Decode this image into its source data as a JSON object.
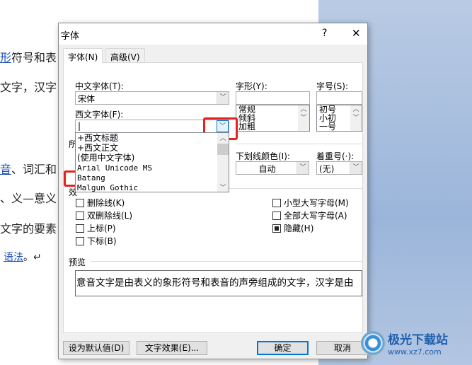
{
  "document": {
    "lines": [
      {
        "link": "形",
        "text": "符号和表"
      },
      {
        "link": "",
        "text": "文字，汉字"
      },
      {
        "link": "音",
        "text": "、词汇和"
      },
      {
        "link": "",
        "text": "、义—意义"
      },
      {
        "link": "",
        "text": "文字的要素"
      },
      {
        "link": "语法",
        "text": "。↵"
      }
    ]
  },
  "dialog": {
    "title": "字体",
    "help": "?",
    "close": "✕",
    "tabs": [
      {
        "label": "字体(N)",
        "active": true
      },
      {
        "label": "高级(V)",
        "active": false
      }
    ],
    "chinese_font": {
      "label": "中文字体(T):",
      "value": "宋体"
    },
    "western_font": {
      "label": "西文字体(F):",
      "value": "|",
      "options": [
        "+西文标题",
        "+西文正文",
        "(使用中文字体)",
        "Arial Unicode MS",
        "Batang",
        "Malgun Gothic"
      ]
    },
    "style": {
      "label": "字形(Y):",
      "value": "",
      "options": [
        "常规",
        "倾斜",
        "加粗"
      ]
    },
    "size": {
      "label": "字号(S):",
      "value": "",
      "options": [
        "初号",
        "小初",
        "一号"
      ]
    },
    "all_text_group": "所",
    "underline_color": {
      "label": "下划线颜色(I):",
      "value": "自动"
    },
    "emphasis": {
      "label": "着重号(·):",
      "value": "(无)"
    },
    "effects_group": "效",
    "effects_left": [
      {
        "label": "删除线(K)",
        "checked": false
      },
      {
        "label": "双删除线(L)",
        "checked": false
      },
      {
        "label": "上标(P)",
        "checked": false
      },
      {
        "label": "下标(B)",
        "checked": false
      }
    ],
    "effects_right": [
      {
        "label": "小型大写字母(M)",
        "checked": false
      },
      {
        "label": "全部大写字母(A)",
        "checked": false
      },
      {
        "label": "隐藏(H)",
        "checked": true
      }
    ],
    "preview": {
      "label": "预览",
      "text": "意音文字是由表义的象形符号和表音的声旁组成的文字，汉字是由"
    },
    "buttons": {
      "default": "设为默认值(D)",
      "effects": "文字效果(E)...",
      "ok": "确定",
      "cancel": "取消"
    }
  },
  "watermark": {
    "text": "极光下载站",
    "url": "www.xz7.com"
  },
  "colors": {
    "highlight": "#e8201e",
    "accent": "#0078d7"
  }
}
